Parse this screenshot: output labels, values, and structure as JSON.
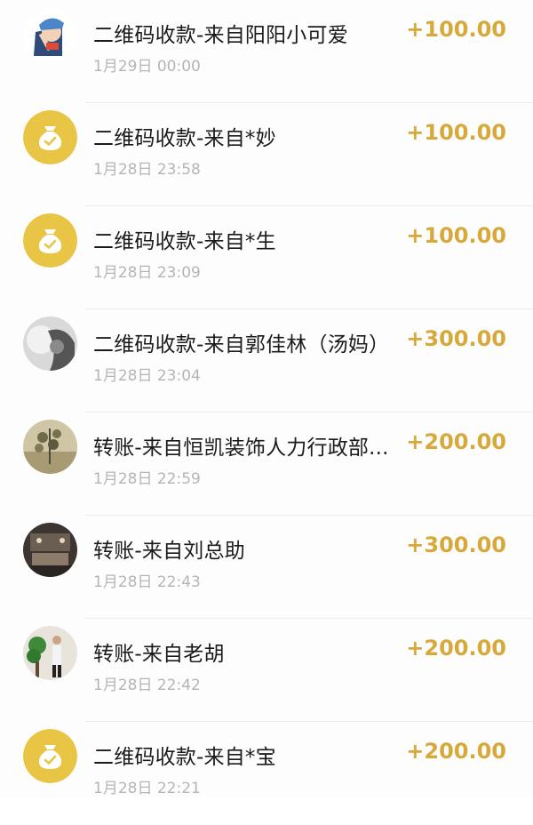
{
  "colors": {
    "amount": "#d6a93a",
    "coin_bg": "#e9c545",
    "title": "#1b1b1b",
    "time": "#b5b5b5"
  },
  "transactions": [
    {
      "title": "二维码收款-来自阳阳小可爱",
      "time": "1月29日 00:00",
      "amount": "+100.00",
      "avatar": "cartoon-avatar-icon"
    },
    {
      "title": "二维码收款-来自*妙",
      "time": "1月28日 23:58",
      "amount": "+100.00",
      "avatar": "money-bag-icon"
    },
    {
      "title": "二维码收款-来自*生",
      "time": "1月28日 23:09",
      "amount": "+100.00",
      "avatar": "money-bag-icon"
    },
    {
      "title": "二维码收款-来自郭佳林（汤妈）",
      "time": "1月28日 23:04",
      "amount": "+300.00",
      "avatar": "photo-avatar-icon"
    },
    {
      "title": "转账-来自恒凯装饰人力行政部...",
      "time": "1月28日 22:59",
      "amount": "+200.00",
      "avatar": "photo-avatar-icon"
    },
    {
      "title": "转账-来自刘总助",
      "time": "1月28日 22:43",
      "amount": "+300.00",
      "avatar": "photo-avatar-icon"
    },
    {
      "title": "转账-来自老胡",
      "time": "1月28日 22:42",
      "amount": "+200.00",
      "avatar": "photo-avatar-icon"
    },
    {
      "title": "二维码收款-来自*宝",
      "time": "1月28日 22:21",
      "amount": "+200.00",
      "avatar": "money-bag-icon"
    }
  ]
}
